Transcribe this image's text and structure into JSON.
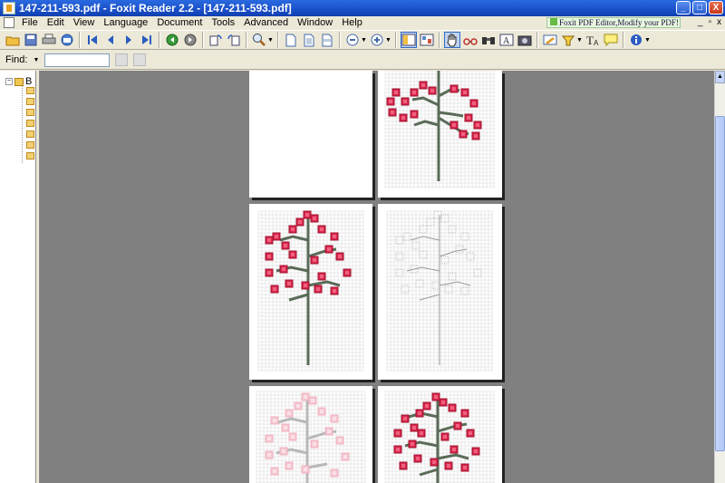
{
  "window": {
    "title": "147-211-593.pdf - Foxit Reader 2.2 - [147-211-593.pdf]",
    "controls": {
      "minimize": "_",
      "maximize": "□",
      "close": "X"
    }
  },
  "menubar": {
    "items": [
      {
        "label": "File"
      },
      {
        "label": "Edit"
      },
      {
        "label": "View"
      },
      {
        "label": "Language"
      },
      {
        "label": "Document"
      },
      {
        "label": "Tools"
      },
      {
        "label": "Advanced"
      },
      {
        "label": "Window"
      },
      {
        "label": "Help"
      }
    ],
    "promo": "Foxit PDF Editor,Modify your PDF!",
    "mdi_controls": {
      "minimize": "_",
      "restore": "▫",
      "close": "x"
    }
  },
  "toolbar": {
    "buttons": [
      {
        "icon": "open-folder-icon"
      },
      {
        "icon": "save-icon"
      },
      {
        "icon": "print-icon"
      },
      {
        "icon": "email-icon"
      },
      {
        "icon": "first-page-icon"
      },
      {
        "icon": "previous-page-icon"
      },
      {
        "icon": "next-page-icon"
      },
      {
        "icon": "last-page-icon"
      },
      {
        "icon": "go-back-icon"
      },
      {
        "icon": "go-forward-icon"
      },
      {
        "icon": "rotate-left-icon"
      },
      {
        "icon": "rotate-right-icon"
      },
      {
        "icon": "zoom-icon"
      },
      {
        "icon": "actual-size-icon"
      },
      {
        "icon": "fit-page-icon"
      },
      {
        "icon": "fit-width-icon"
      },
      {
        "icon": "zoom-out-icon"
      },
      {
        "icon": "zoom-in-icon"
      },
      {
        "icon": "bookmarks-pane-icon"
      },
      {
        "icon": "thumbnails-icon"
      },
      {
        "icon": "hand-tool-icon"
      },
      {
        "icon": "text-select-icon"
      },
      {
        "icon": "find-binoculars-icon"
      },
      {
        "icon": "text-viewer-icon"
      },
      {
        "icon": "snapshot-icon"
      },
      {
        "icon": "typewriter-icon"
      },
      {
        "icon": "highlighter-icon"
      },
      {
        "icon": "text-tool-icon"
      },
      {
        "icon": "note-icon"
      },
      {
        "icon": "info-icon"
      }
    ]
  },
  "findbar": {
    "label": "Find:",
    "value": ""
  },
  "bookmarks": {
    "root_label": "B"
  },
  "colors": {
    "accent": "#2a6ae0",
    "workspace": "#808080",
    "berry": "#d02040",
    "stem": "#5a6b58"
  }
}
